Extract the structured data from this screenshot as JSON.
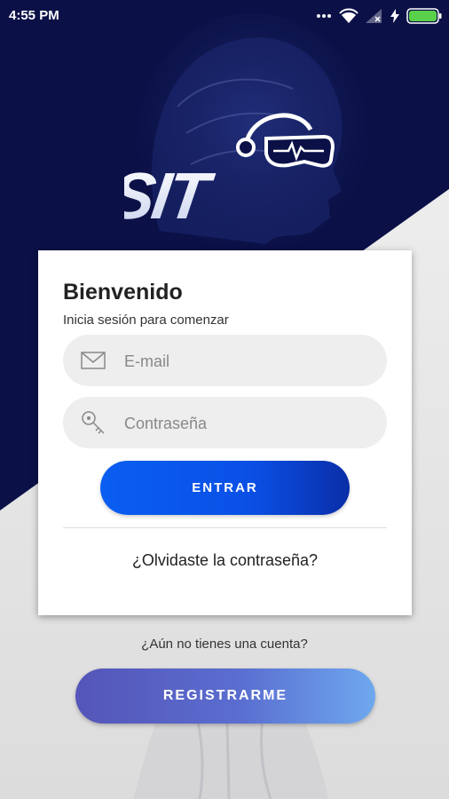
{
  "status_bar": {
    "time": "4:55 PM",
    "icons": [
      "dots-icon",
      "wifi-icon",
      "signal-icon",
      "charging-icon",
      "battery-icon"
    ]
  },
  "brand": {
    "logo_text": "SIT",
    "header_color": "#0b1147",
    "accent": "#0a5ef0"
  },
  "login_card": {
    "title": "Bienvenido",
    "subtitle": "Inicia sesión para comenzar",
    "email_placeholder": "E-mail",
    "password_placeholder": "Contraseña",
    "submit_label": "ENTRAR",
    "forgot_password": "¿Olvidaste la contraseña?"
  },
  "register": {
    "prompt": "¿Aún no tienes una cuenta?",
    "button_label": "REGISTRARME"
  }
}
